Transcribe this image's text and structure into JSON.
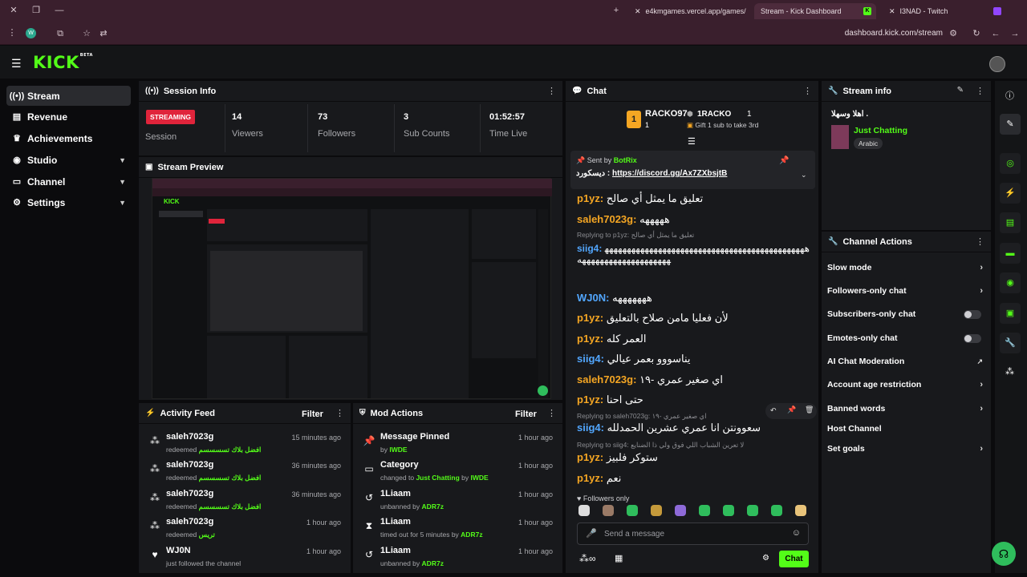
{
  "browser": {
    "tabs": [
      {
        "label": "e4kmgames.vercel.app/games/"
      },
      {
        "label": "Stream - Kick Dashboard"
      },
      {
        "label": "I3NAD - Twitch"
      }
    ],
    "url": "dashboard.kick.com/stream",
    "profile_initial": "W"
  },
  "app": {
    "logo": "KICK",
    "logo_sup": "BETA"
  },
  "sidebar": {
    "items": [
      {
        "label": "Stream",
        "icon": "radio-icon"
      },
      {
        "label": "Revenue",
        "icon": "revenue-icon"
      },
      {
        "label": "Achievements",
        "icon": "trophy-icon"
      },
      {
        "label": "Studio",
        "icon": "studio-icon"
      },
      {
        "label": "Channel",
        "icon": "channel-icon"
      },
      {
        "label": "Settings",
        "icon": "gear-icon"
      }
    ]
  },
  "session": {
    "title": "Session Info",
    "status": "STREAMING",
    "status_label": "Session",
    "stats": [
      {
        "value": "14",
        "label": "Viewers"
      },
      {
        "value": "73",
        "label": "Followers"
      },
      {
        "value": "3",
        "label": "Sub Counts"
      },
      {
        "value": "01:52:57",
        "label": "Time Live"
      }
    ]
  },
  "preview": {
    "title": "Stream Preview"
  },
  "activity": {
    "title": "Activity Feed",
    "filter": "Filter",
    "items": [
      {
        "user": "saleh7023g",
        "action": "redeemed",
        "reward": "افضل بلاك تسسسسم",
        "time": "15 minutes ago"
      },
      {
        "user": "saleh7023g",
        "action": "redeemed",
        "reward": "افضل بلاك تسسسسم",
        "time": "36 minutes ago"
      },
      {
        "user": "saleh7023g",
        "action": "redeemed",
        "reward": "افضل بلاك تسسسسم",
        "time": "36 minutes ago"
      },
      {
        "user": "saleh7023g",
        "action": "redeemed",
        "reward": "تريس",
        "time": "1 hour ago"
      },
      {
        "user": "WJ0N",
        "action": "just followed the channel",
        "reward": "",
        "time": "1 hour ago"
      }
    ]
  },
  "mod": {
    "title": "Mod Actions",
    "filter": "Filter",
    "items": [
      {
        "title": "Message Pinned",
        "pre": "by",
        "name": "IWDE",
        "mid": "",
        "name2": "",
        "time": "1 hour ago"
      },
      {
        "title": "Category",
        "pre": "changed to",
        "name": "Just Chatting",
        "mid": "by",
        "name2": "IWDE",
        "time": "1 hour ago"
      },
      {
        "title": "1Liaam",
        "pre": "unbanned by",
        "name": "ADR7z",
        "mid": "",
        "name2": "",
        "time": "1 hour ago"
      },
      {
        "title": "1Liaam",
        "pre": "timed out for 5 minutes by",
        "name": "ADR7z",
        "mid": "",
        "name2": "",
        "time": "1 hour ago"
      },
      {
        "title": "1Liaam",
        "pre": "unbanned by",
        "name": "ADR7z",
        "mid": "",
        "name2": "",
        "time": "1 hour ago"
      }
    ]
  },
  "chat": {
    "title": "Chat",
    "leaders": {
      "rank1": "RACKO97",
      "rank1_count": "1",
      "rank2": "1RACKO",
      "rank2_count": "1",
      "gift_text": "Gift 1 sub to take 3rd"
    },
    "pinned": {
      "sent_by": "Sent by",
      "bot": "BotRix",
      "text": "ديسكورد :",
      "link": "https://discord.gg/Ax7ZXbsjtB"
    },
    "messages": [
      {
        "user": "p1yz",
        "color": "#f5a623",
        "text": "تعليق ما يمثل أي صالح",
        "reply": ""
      },
      {
        "user": "saleh7023g",
        "color": "#f5a623",
        "text": "هههههه",
        "reply": ""
      },
      {
        "user": "siig4",
        "color": "#52a7ff",
        "text": "ههههههههههههههههههههههههههههههههههههههههههههههههههههههههههههههههههه",
        "reply": "Replying to p1yz: تعليق ما يمثل أي صالح"
      },
      {
        "user": "WJ0N",
        "color": "#52a7ff",
        "text": "هههههههه",
        "reply": ""
      },
      {
        "user": "p1yz",
        "color": "#f5a623",
        "text": "لأن فعليا مامن صلاح بالتعليق",
        "reply": ""
      },
      {
        "user": "p1yz",
        "color": "#f5a623",
        "text": "العمر كله",
        "reply": ""
      },
      {
        "user": "siig4",
        "color": "#52a7ff",
        "text": "يناسووو بعمر عيالي",
        "reply": ""
      },
      {
        "user": "saleh7023g",
        "color": "#f5a623",
        "text": "اي صغير عمري -١٩",
        "reply": ""
      },
      {
        "user": "p1yz",
        "color": "#f5a623",
        "text": "حتى احنا",
        "reply": ""
      },
      {
        "user": "siig4",
        "color": "#52a7ff",
        "text": "سعوونتن انا عمري عشرين الحمدلله",
        "reply": "Replying to saleh7023g: اي صغير عمري -١٩"
      },
      {
        "user": "p1yz",
        "color": "#f5a623",
        "text": "ستوكر فلبيز",
        "reply": "Replying to siig4: لا تعرين الشباب اللي فوق ولي ذا الضنايع"
      },
      {
        "user": "p1yz",
        "color": "#f5a623",
        "text": "نعم",
        "reply": ""
      }
    ],
    "followers_only": "Followers only",
    "placeholder": "Send a message",
    "send": "Chat"
  },
  "stream_info": {
    "title": "Stream info",
    "stream_title": "اهلا وسهلا .",
    "category": "Just Chatting",
    "language": "Arabic"
  },
  "channel_actions": {
    "title": "Channel Actions",
    "items": [
      {
        "label": "Slow mode",
        "kind": "arrow"
      },
      {
        "label": "Followers-only chat",
        "kind": "arrow"
      },
      {
        "label": "Subscribers-only chat",
        "kind": "toggle"
      },
      {
        "label": "Emotes-only chat",
        "kind": "toggle"
      },
      {
        "label": "AI Chat Moderation",
        "kind": "external"
      },
      {
        "label": "Account age restriction",
        "kind": "arrow"
      },
      {
        "label": "Banned words",
        "kind": "arrow"
      },
      {
        "label": "Host Channel",
        "kind": "none"
      },
      {
        "label": "Set goals",
        "kind": "arrow"
      }
    ]
  },
  "colors": {
    "accent": "#53fc18",
    "streaming": "#e0243b",
    "panel": "#18191c"
  }
}
